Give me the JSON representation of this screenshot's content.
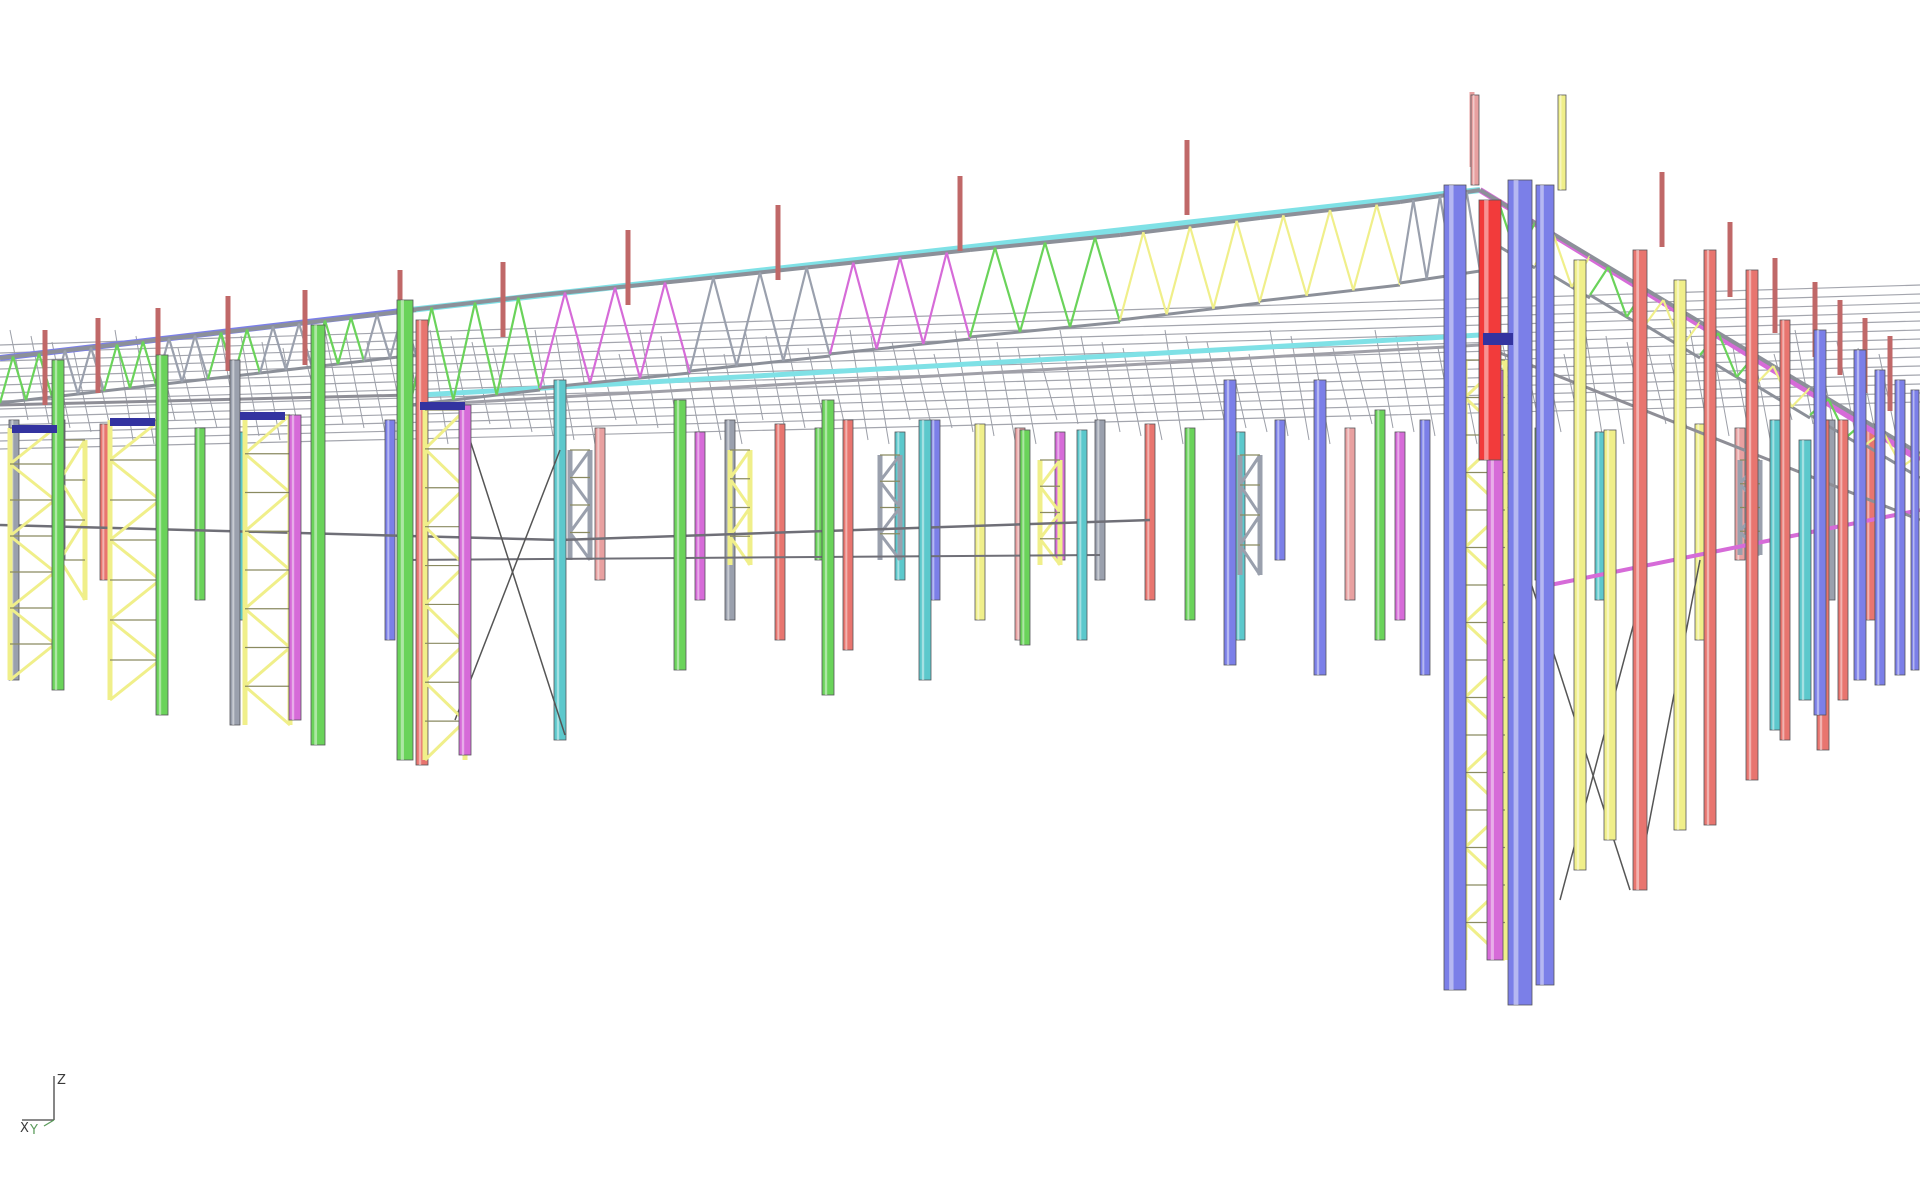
{
  "viewport": {
    "background": "#ffffff"
  },
  "axis_triad": {
    "z_label": "Z",
    "x_label": "X",
    "y_label": "Y"
  },
  "member_colors": {
    "blue": "#7b7fe8",
    "red": "#e8756f",
    "green": "#6ad35a",
    "yellow": "#f0ef8a",
    "magenta": "#d66bd8",
    "cyan": "#5cc8cc",
    "gray": "#9aa0ad",
    "pink": "#e8a0a0",
    "bright_red": "#f23b3b"
  }
}
